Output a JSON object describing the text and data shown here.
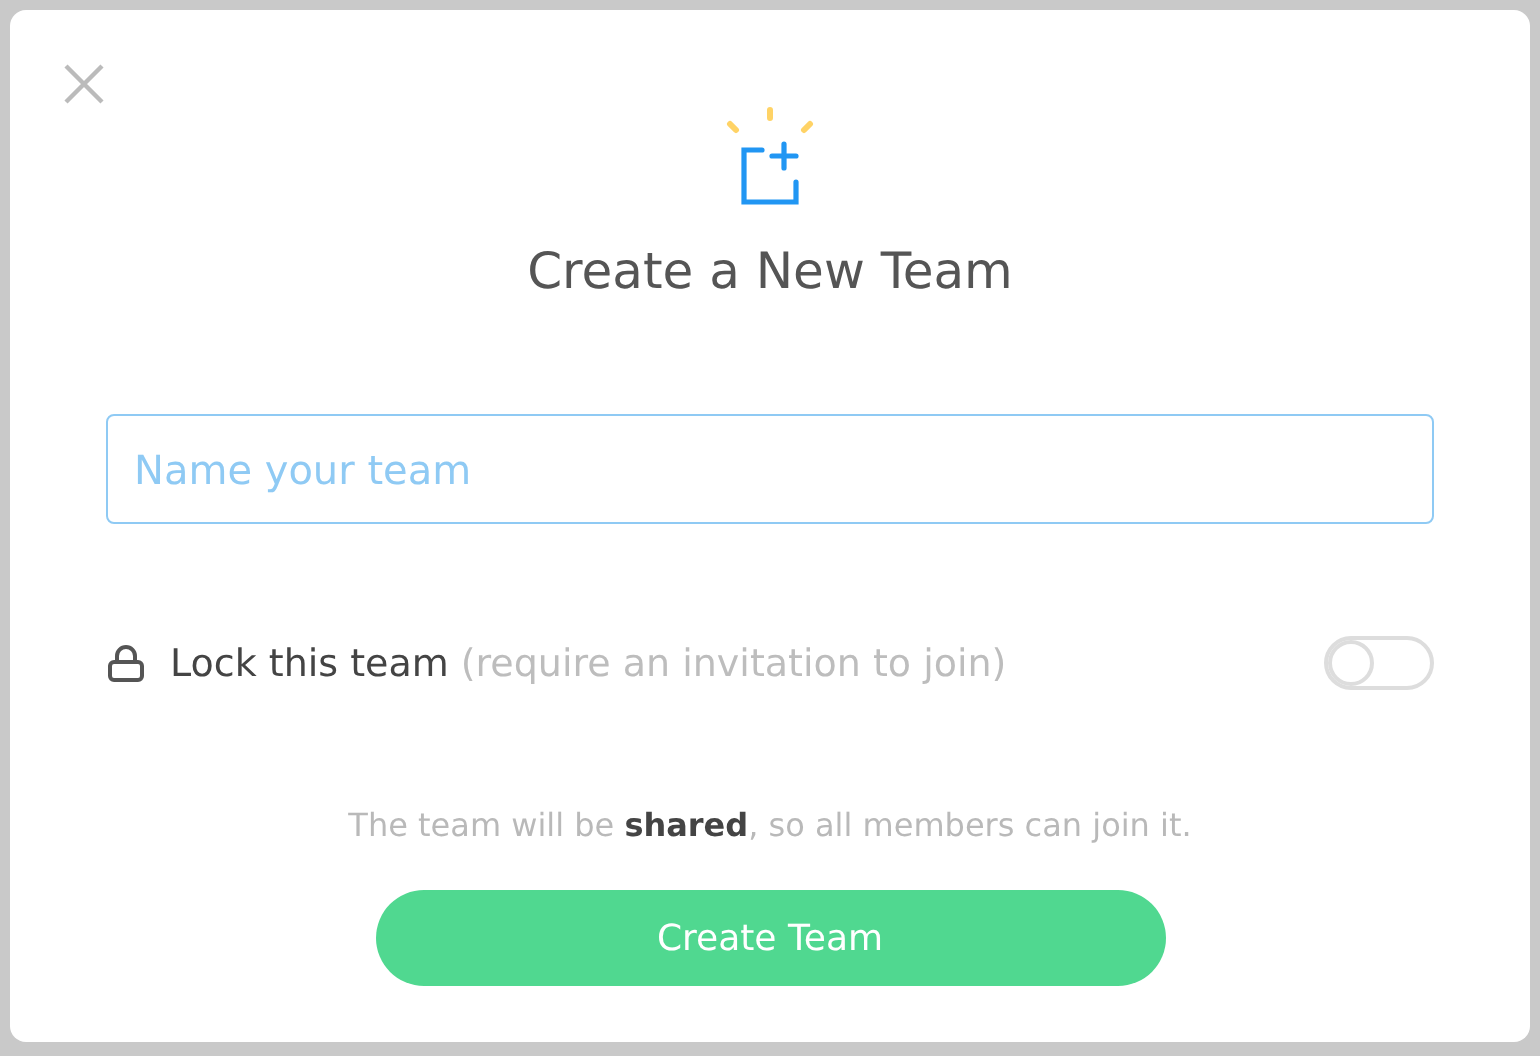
{
  "dialog": {
    "title": "Create a New Team",
    "name_field": {
      "placeholder": "Name your team",
      "focused": true
    },
    "lock": {
      "label": "Lock this team",
      "hint": "(require an invitation to join)",
      "on": false
    },
    "note": "The team will be **shared**, so all members can join it.",
    "submit": "Create Team"
  }
}
